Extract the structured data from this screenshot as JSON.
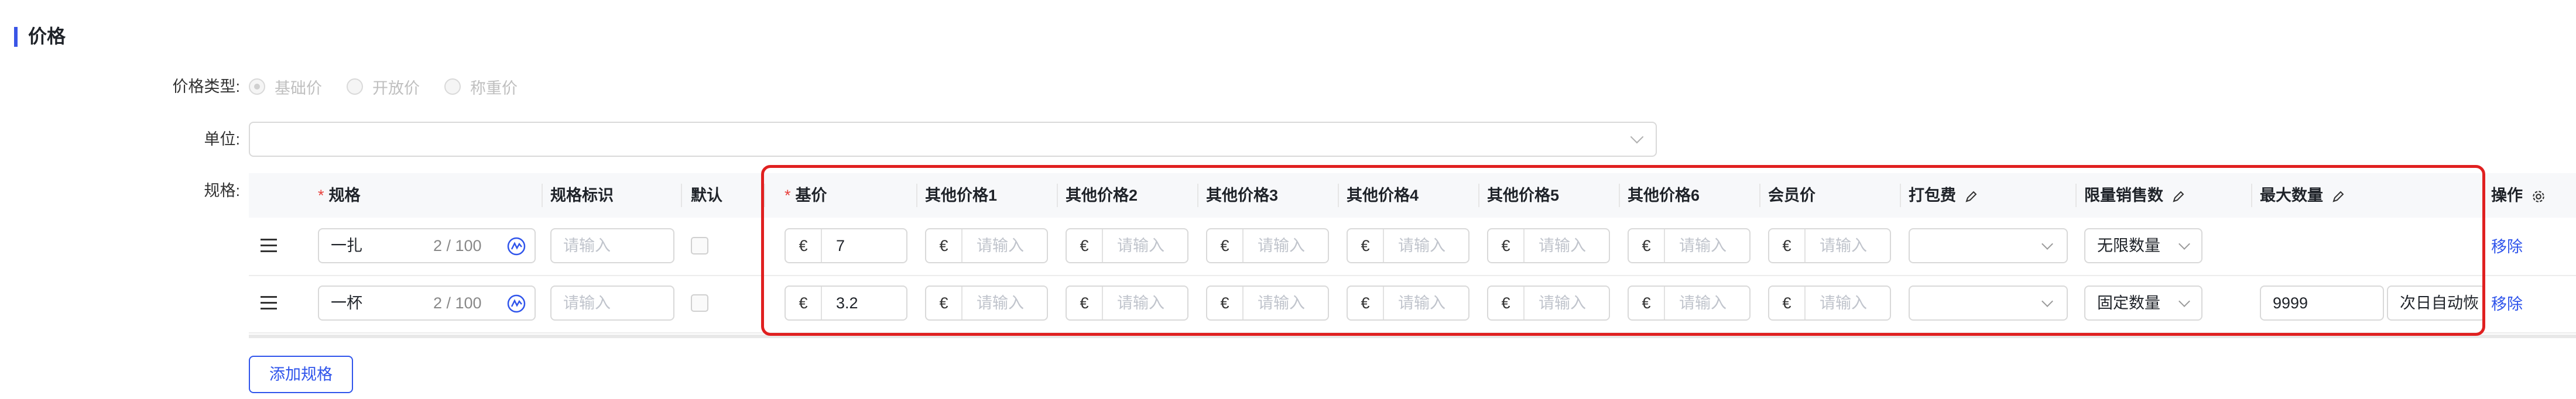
{
  "section": {
    "title": "价格"
  },
  "price_type": {
    "label": "价格类型:",
    "options": [
      {
        "label": "基础价",
        "checked": true
      },
      {
        "label": "开放价",
        "checked": false
      },
      {
        "label": "称重价",
        "checked": false
      }
    ]
  },
  "unit": {
    "label": "单位:",
    "value": ""
  },
  "spec": {
    "label": "规格:"
  },
  "table": {
    "headers": {
      "spec": "规格",
      "spec_id": "规格标识",
      "default": "默认",
      "base_price": "基价",
      "other1": "其他价格1",
      "other2": "其他价格2",
      "other3": "其他价格3",
      "other4": "其他价格4",
      "other5": "其他价格5",
      "other6": "其他价格6",
      "member": "会员价",
      "packing": "打包费",
      "limit": "限量销售数",
      "max": "最大数量",
      "action": "操作"
    },
    "currency": "€",
    "placeholder": "请输入",
    "rows": [
      {
        "spec": "一扎",
        "count": "2 / 100",
        "base_price": "7",
        "limit": "无限数量",
        "max": "",
        "restore": "",
        "action": "移除"
      },
      {
        "spec": "一杯",
        "count": "2 / 100",
        "base_price": "3.2",
        "limit": "固定数量",
        "max": "9999",
        "restore": "次日自动恢",
        "action": "移除"
      }
    ]
  },
  "add_button": "添加规格",
  "colors": {
    "accent": "#2f54eb",
    "required": "#e8413d",
    "highlight": "#e02020"
  }
}
